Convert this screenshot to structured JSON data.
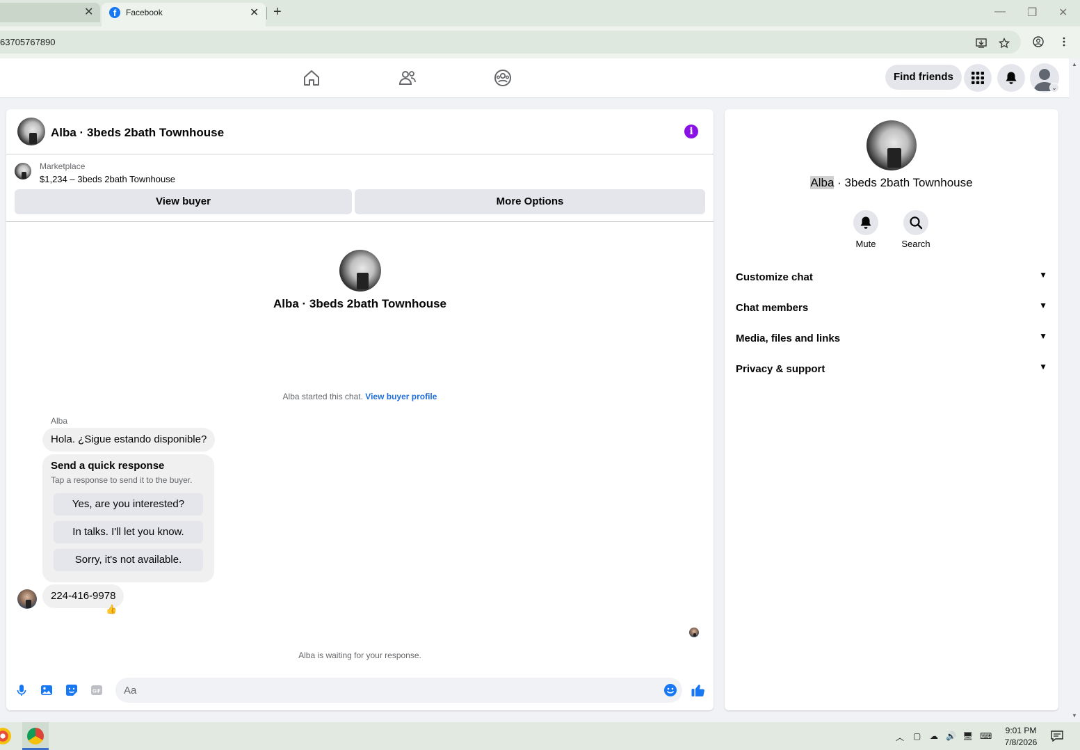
{
  "browser": {
    "tab_active_title": "Facebook",
    "url_fragment": "63705767890",
    "new_tab_symbol": "+",
    "close_symbol": "✕"
  },
  "fb_header": {
    "find_friends": "Find friends"
  },
  "chat": {
    "title": "Alba · 3beds 2bath Townhouse",
    "marketplace_label": "Marketplace",
    "listing": "$1,234 – 3beds 2bath Townhouse",
    "view_buyer": "View buyer",
    "more_options": "More Options",
    "center_name": "Alba · 3beds 2bath Townhouse",
    "started_text": "Alba started this chat.",
    "view_buyer_profile": "View buyer profile",
    "sender": "Alba",
    "message1": "Hola. ¿Sigue estando disponible?",
    "quick_title": "Send a quick response",
    "quick_sub": "Tap a response to send it to the buyer.",
    "quick_options": [
      "Yes, are you interested?",
      "In talks. I'll let you know.",
      "Sorry, it's not available."
    ],
    "message2": "224-416-9978",
    "reaction": "👍",
    "waiting": "Alba is waiting for your response.",
    "composer_placeholder": "Aa"
  },
  "info_panel": {
    "name_highlight": "Alba",
    "name_rest": " · 3beds 2bath Townhouse",
    "mute": "Mute",
    "search": "Search",
    "sections": [
      "Customize chat",
      "Chat members",
      "Media, files and links",
      "Privacy & support"
    ]
  },
  "taskbar": {
    "time": "9:01 PM",
    "date": "7/8/2026"
  },
  "colors": {
    "fb_blue": "#1877f2",
    "info_purple": "#8a12e6",
    "link_blue": "#216fdb"
  }
}
